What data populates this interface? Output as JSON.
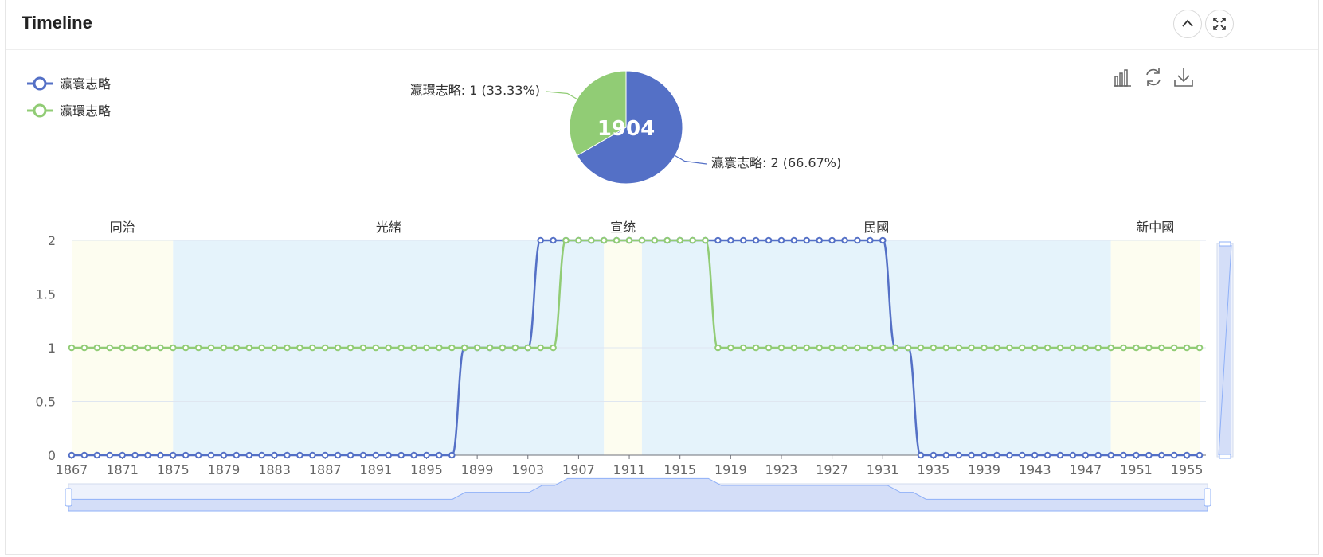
{
  "panel": {
    "title": "Timeline",
    "collapse_icon": "chevron-up-icon",
    "fullscreen_icon": "fullscreen-icon"
  },
  "toolbox": {
    "icons": [
      "bar-chart-icon",
      "refresh-icon",
      "download-icon"
    ]
  },
  "colors": {
    "series1": "#5470c6",
    "series2": "#91cc75",
    "band_light": "#fdfdf0",
    "band_blue": "#e5f3fb",
    "zoom_fill": "#d4def8"
  },
  "chart_data": [
    {
      "type": "pie",
      "center_label": "1904",
      "slices": [
        {
          "name": "瀛寰志略",
          "value": 2,
          "percent": "66.67%",
          "label": "瀛寰志略: 2 (66.67%)"
        },
        {
          "name": "瀛環志略",
          "value": 1,
          "percent": "33.33%",
          "label": "瀛環志略: 1 (33.33%)"
        }
      ]
    },
    {
      "type": "line",
      "x_ticks": [
        "1867",
        "1871",
        "1875",
        "1879",
        "1883",
        "1887",
        "1891",
        "1895",
        "1899",
        "1903",
        "1907",
        "1911",
        "1915",
        "1919",
        "1923",
        "1927",
        "1931",
        "1935",
        "1939",
        "1943",
        "1947",
        "1951",
        "1955"
      ],
      "y_ticks": [
        "0",
        "0.5",
        "1",
        "1.5",
        "2"
      ],
      "xlim": [
        1867,
        1956
      ],
      "ylim": [
        0,
        2
      ],
      "legend_position": "top-left",
      "eras": [
        {
          "name": "同治",
          "start": 1867,
          "end": 1875,
          "shade": "light"
        },
        {
          "name": "光緒",
          "start": 1875,
          "end": 1909,
          "shade": "blue"
        },
        {
          "name": "宣统",
          "start": 1909,
          "end": 1912,
          "shade": "light"
        },
        {
          "name": "民國",
          "start": 1912,
          "end": 1949,
          "shade": "blue"
        },
        {
          "name": "新中國",
          "start": 1949,
          "end": 1956,
          "shade": "light"
        }
      ],
      "series": [
        {
          "name": "瀛寰志略",
          "segments": [
            {
              "start": 1867,
              "end": 1897,
              "value": 0
            },
            {
              "start": 1898,
              "end": 1903,
              "value": 1
            },
            {
              "start": 1904,
              "end": 1931,
              "value": 2
            },
            {
              "start": 1932,
              "end": 1933,
              "value": 1
            },
            {
              "start": 1934,
              "end": 1956,
              "value": 0
            }
          ]
        },
        {
          "name": "瀛環志略",
          "segments": [
            {
              "start": 1867,
              "end": 1905,
              "value": 1
            },
            {
              "start": 1906,
              "end": 1917,
              "value": 2
            },
            {
              "start": 1918,
              "end": 1956,
              "value": 1
            }
          ]
        }
      ]
    }
  ]
}
